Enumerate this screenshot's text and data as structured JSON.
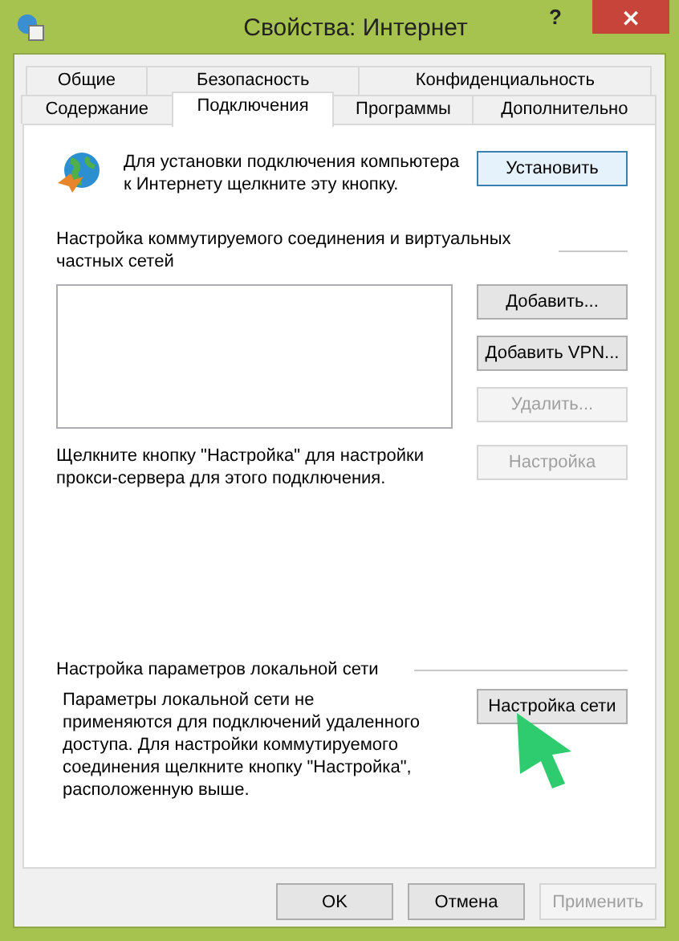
{
  "window": {
    "title": "Свойства: Интернет",
    "help": "?",
    "close": "×"
  },
  "tab_rows": [
    [
      {
        "label": "Общие",
        "selected": false
      },
      {
        "label": "Безопасность",
        "selected": false
      },
      {
        "label": "Конфиденциальность",
        "selected": false
      }
    ],
    [
      {
        "label": "Содержание",
        "selected": false
      },
      {
        "label": "Подключения",
        "selected": true
      },
      {
        "label": "Программы",
        "selected": false
      },
      {
        "label": "Дополнительно",
        "selected": false
      }
    ]
  ],
  "setup": {
    "text": "Для установки подключения компьютера к Интернету щелкните эту кнопку.",
    "button": "Установить"
  },
  "dialup": {
    "heading": "Настройка коммутируемого соединения и виртуальных частных сетей",
    "buttons": [
      {
        "label": "Добавить...",
        "disabled": false
      },
      {
        "label": "Добавить VPN...",
        "disabled": false
      },
      {
        "label": "Удалить...",
        "disabled": true
      }
    ],
    "proxy_text": "Щелкните кнопку \"Настройка\" для настройки прокси-сервера для этого подключения.",
    "proxy_button": {
      "label": "Настройка",
      "disabled": true
    }
  },
  "lan": {
    "heading": "Настройка параметров локальной сети",
    "text": "Параметры локальной сети не применяются для подключений удаленного доступа. Для настройки коммутируемого соединения щелкните кнопку \"Настройка\", расположенную выше.",
    "button": {
      "label": "Настройка сети",
      "disabled": false
    }
  },
  "footer_buttons": [
    {
      "label": "OK",
      "disabled": false
    },
    {
      "label": "Отмена",
      "disabled": false
    },
    {
      "label": "Применить",
      "disabled": true
    }
  ]
}
